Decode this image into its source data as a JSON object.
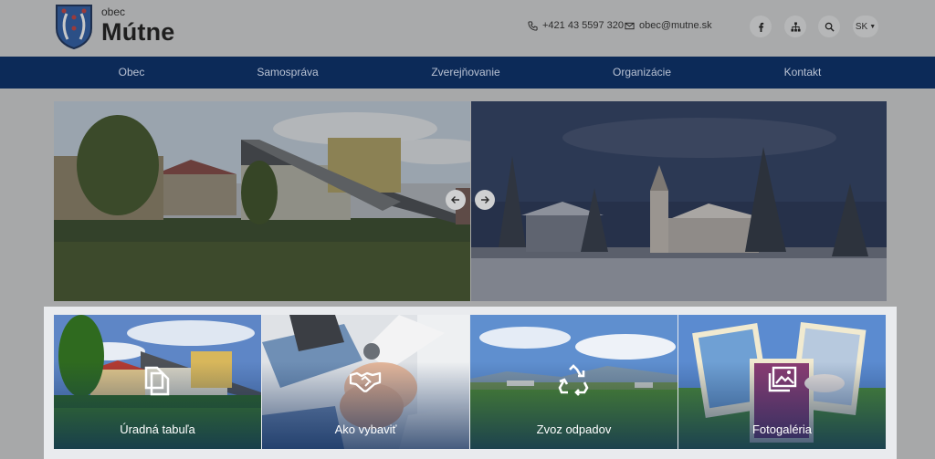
{
  "header": {
    "brand_small": "obec",
    "brand_name": "Mútne",
    "phone": "+421 43 5597 320",
    "email": "obec@mutne.sk",
    "language": "SK",
    "icons": [
      "facebook-icon",
      "sitemap-icon",
      "search-icon"
    ]
  },
  "nav": {
    "items": [
      "Obec",
      "Samospráva",
      "Zverejňovanie",
      "Organizácie",
      "Kontakt"
    ]
  },
  "slider": {
    "slides": [
      "summer-municipal-building",
      "winter-church"
    ]
  },
  "tiles": [
    {
      "label": "Úradná tabuľa",
      "icon": "documents-icon"
    },
    {
      "label": "Ako vybaviť",
      "icon": "handshake-icon"
    },
    {
      "label": "Zvoz odpadov",
      "icon": "recycle-icon"
    },
    {
      "label": "Fotogaléria",
      "icon": "gallery-icon"
    }
  ],
  "colors": {
    "nav_background": "#0c2a58",
    "overlay": "#a7a8a9"
  }
}
